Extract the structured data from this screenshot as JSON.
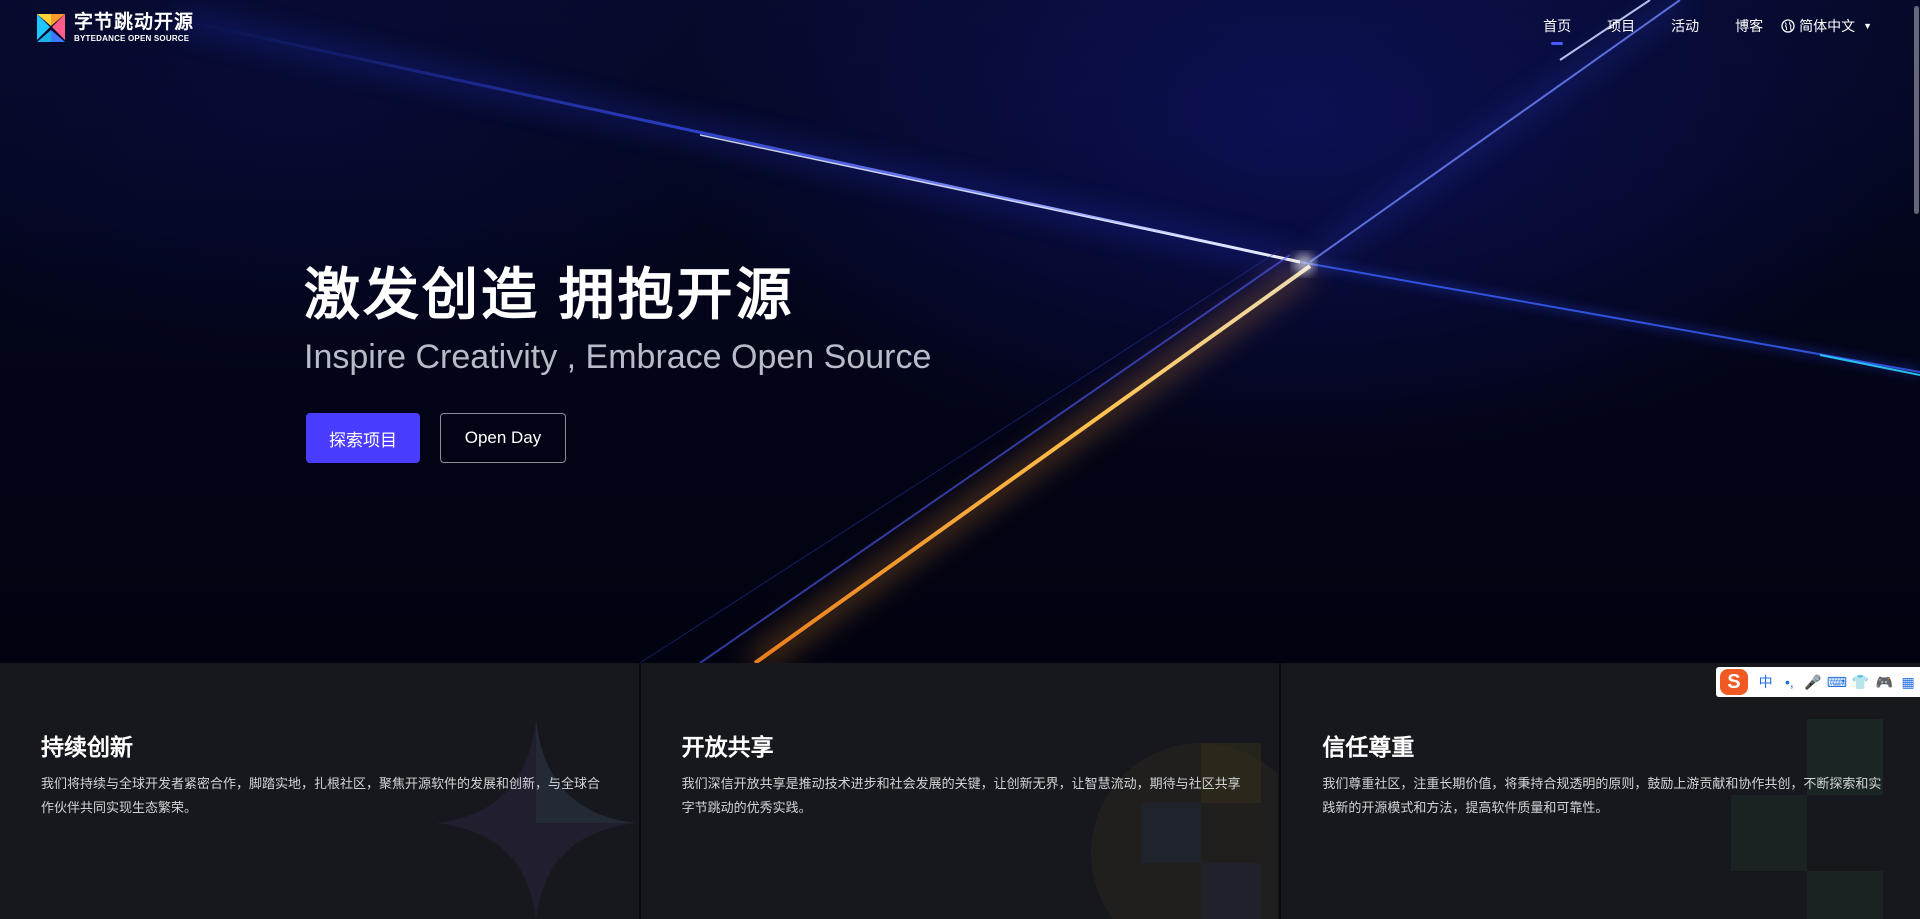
{
  "brand": {
    "name_cn": "字节跳动开源",
    "name_en": "BYTEDANCE OPEN SOURCE",
    "colors": {
      "primary": "#4a3cff",
      "accent_blue": "#4b5cff",
      "glow_orange": "#ffb43a"
    }
  },
  "nav": {
    "items": [
      {
        "label": "首页",
        "active": true
      },
      {
        "label": "项目",
        "active": false
      },
      {
        "label": "活动",
        "active": false
      },
      {
        "label": "博客",
        "active": false
      }
    ],
    "language": {
      "label": "简体中文",
      "icon": "globe-icon"
    }
  },
  "hero": {
    "title": "激发创造  拥抱开源",
    "subtitle": "Inspire Creativity , Embrace Open Source",
    "primary_button": "探索项目",
    "secondary_button": "Open Day"
  },
  "features": [
    {
      "title": "持续创新",
      "description": "我们将持续与全球开发者紧密合作，脚踏实地，扎根社区，聚焦开源软件的发展和创新，与全球合作伙伴共同实现生态繁荣。"
    },
    {
      "title": "开放共享",
      "description": "我们深信开放共享是推动技术进步和社会发展的关键，让创新无界，让智慧流动，期待与社区共享字节跳动的优秀实践。"
    },
    {
      "title": "信任尊重",
      "description": "我们尊重社区，注重长期价值，将秉持合规透明的原则，鼓励上游贡献和协作共创，不断探索和实践新的开源模式和方法，提高软件质量和可靠性。"
    }
  ],
  "ime_toolbar": {
    "logo": "S",
    "items": [
      {
        "label": "中",
        "icon": "chinese-mode-icon"
      },
      {
        "label": "•,",
        "icon": "punctuation-icon"
      },
      {
        "label": "🎤",
        "icon": "microphone-icon"
      },
      {
        "label": "⌨",
        "icon": "keyboard-icon"
      },
      {
        "label": "👕",
        "icon": "skin-icon"
      },
      {
        "label": "🎮",
        "icon": "game-icon"
      },
      {
        "label": "▦",
        "icon": "toolbox-icon"
      }
    ]
  }
}
